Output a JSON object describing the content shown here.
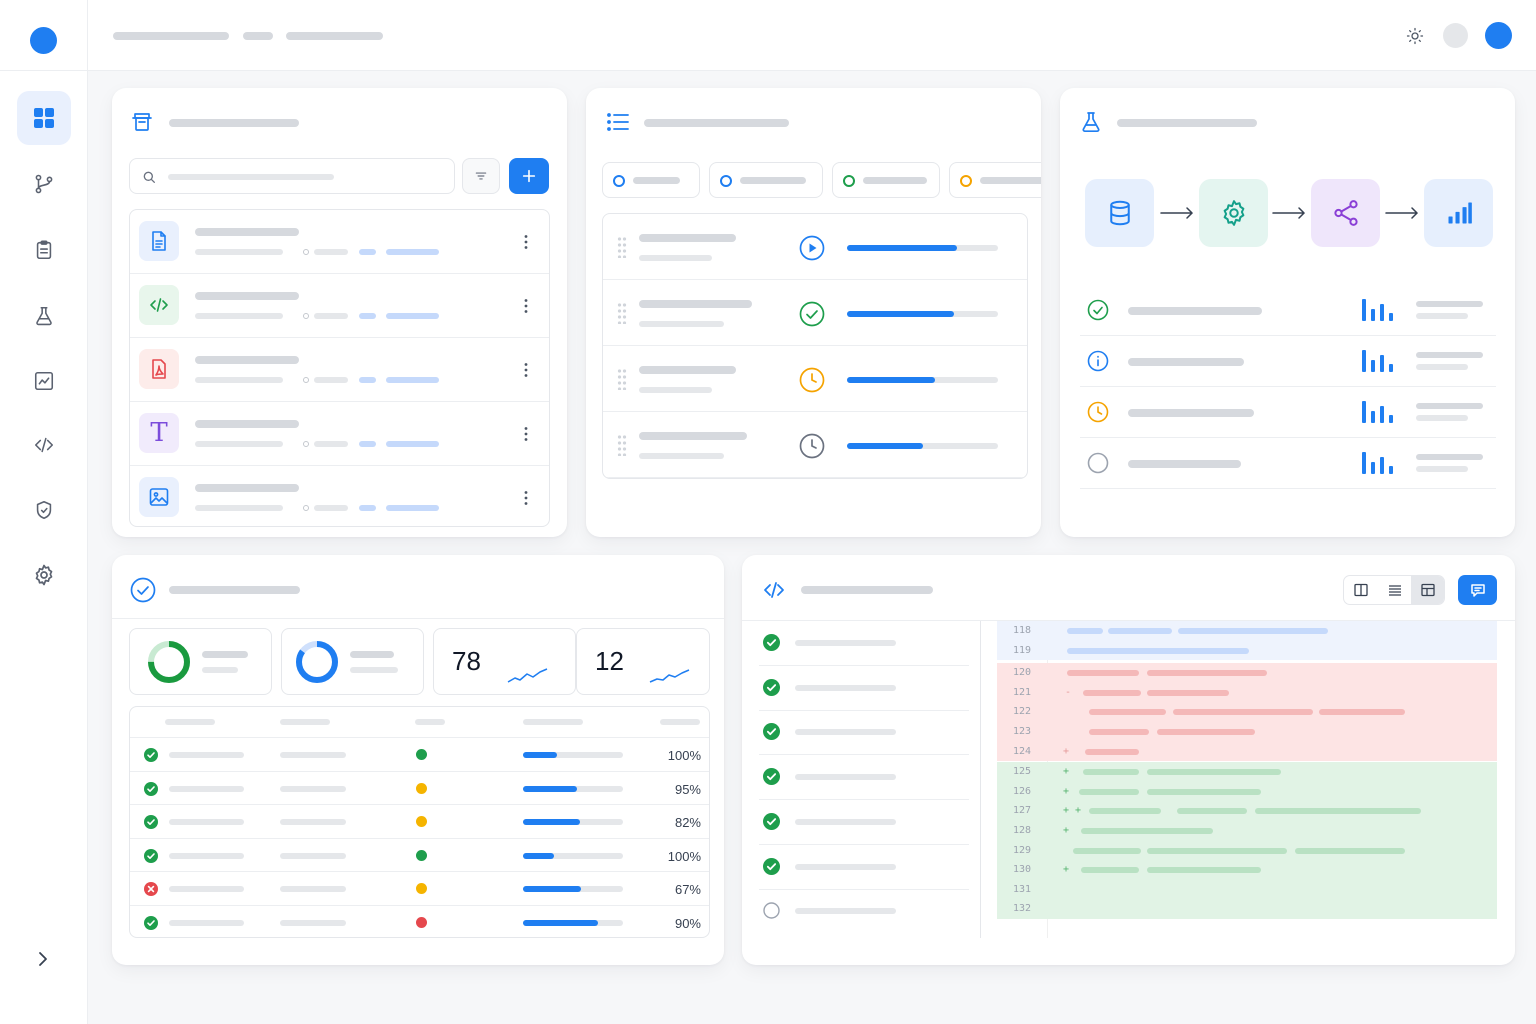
{
  "colors": {
    "primary": "#1f7ef1",
    "success": "#1e9e4c",
    "warning": "#f5b400",
    "danger": "#e5484d",
    "muted": "#9ca3af"
  },
  "sidebar": {
    "logo": "logo-dot",
    "items": [
      {
        "name": "dashboard",
        "icon": "grid-icon",
        "active": true
      },
      {
        "name": "branches",
        "icon": "git-branch-icon"
      },
      {
        "name": "tasks",
        "icon": "clipboard-icon"
      },
      {
        "name": "experiments",
        "icon": "flask-icon"
      },
      {
        "name": "analytics",
        "icon": "chart-line-icon"
      },
      {
        "name": "code",
        "icon": "code-icon"
      },
      {
        "name": "security",
        "icon": "shield-icon"
      },
      {
        "name": "settings",
        "icon": "gear-icon"
      }
    ],
    "collapse_icon": "chevron-right-icon"
  },
  "topbar": {
    "icons": [
      "sun-icon",
      "avatar-placeholder",
      "user-avatar"
    ]
  },
  "files": {
    "icon": "archive-icon",
    "items": [
      {
        "type": "document",
        "icon": "file-text-icon"
      },
      {
        "type": "code",
        "icon": "code-file-icon"
      },
      {
        "type": "pdf",
        "icon": "pdf-icon"
      },
      {
        "type": "text",
        "icon": "text-type-icon",
        "glyph": "T"
      },
      {
        "type": "image",
        "icon": "image-icon"
      }
    ]
  },
  "tasks": {
    "icon": "list-icon",
    "filters": [
      {
        "status": "open",
        "color": "#1f7ef1"
      },
      {
        "status": "open",
        "color": "#1f7ef1"
      },
      {
        "status": "done",
        "color": "#1e9e4c"
      },
      {
        "status": "pending",
        "color": "#f5a300"
      }
    ],
    "items": [
      {
        "status": "running",
        "icon": "play-circle-icon",
        "progress": 0.73
      },
      {
        "status": "done",
        "icon": "check-circle-icon",
        "progress": 0.71
      },
      {
        "status": "pending",
        "icon": "clock-icon",
        "progress": 0.58
      },
      {
        "status": "queued",
        "icon": "clock-icon",
        "progress": 0.5
      }
    ]
  },
  "pipeline": {
    "icon": "flask-icon",
    "stages": [
      {
        "icon": "database-icon"
      },
      {
        "icon": "gear-icon"
      },
      {
        "icon": "share-icon"
      },
      {
        "icon": "bar-chart-icon"
      }
    ],
    "rows": [
      {
        "status": "success",
        "icon": "check-circle-icon"
      },
      {
        "status": "info",
        "icon": "info-circle-icon"
      },
      {
        "status": "pending",
        "icon": "clock-icon"
      },
      {
        "status": "idle",
        "icon": "empty-circle-icon"
      }
    ]
  },
  "tests": {
    "icon": "check-circle-icon",
    "stats": [
      {
        "kind": "donut",
        "value": 0.75
      },
      {
        "kind": "donut",
        "value": 0.85
      },
      {
        "kind": "number",
        "value": "78"
      },
      {
        "kind": "number",
        "value": "12"
      }
    ],
    "rows": [
      {
        "status": "pass",
        "dot": "green",
        "progress": 0.34,
        "pct": "100%"
      },
      {
        "status": "pass",
        "dot": "yellow",
        "progress": 0.54,
        "pct": "95%"
      },
      {
        "status": "pass",
        "dot": "yellow",
        "progress": 0.57,
        "pct": "82%"
      },
      {
        "status": "pass",
        "dot": "green",
        "progress": 0.31,
        "pct": "100%"
      },
      {
        "status": "fail",
        "dot": "yellow",
        "progress": 0.58,
        "pct": "67%"
      },
      {
        "status": "pass",
        "dot": "red",
        "progress": 0.75,
        "pct": "90%"
      }
    ]
  },
  "code_review": {
    "icon": "code-icon",
    "checks": [
      "done",
      "done",
      "done",
      "done",
      "done",
      "done",
      "pending"
    ],
    "view_modes": [
      "split-view-icon",
      "list-view-icon",
      "table-view-icon"
    ],
    "comment_icon": "comment-icon",
    "lines": [
      {
        "n": "118",
        "type": "context",
        "sign": ""
      },
      {
        "n": "119",
        "type": "context",
        "sign": ""
      },
      {
        "n": "120",
        "type": "removed",
        "sign": ""
      },
      {
        "n": "121",
        "type": "removed",
        "sign": "-"
      },
      {
        "n": "122",
        "type": "removed",
        "sign": ""
      },
      {
        "n": "123",
        "type": "removed",
        "sign": ""
      },
      {
        "n": "124",
        "type": "removed",
        "sign": "+"
      },
      {
        "n": "125",
        "type": "added",
        "sign": "+"
      },
      {
        "n": "126",
        "type": "added",
        "sign": "+"
      },
      {
        "n": "127",
        "type": "added",
        "sign": "+ +"
      },
      {
        "n": "128",
        "type": "added",
        "sign": "+"
      },
      {
        "n": "129",
        "type": "added",
        "sign": ""
      },
      {
        "n": "130",
        "type": "added",
        "sign": "+"
      },
      {
        "n": "131",
        "type": "added",
        "sign": ""
      },
      {
        "n": "132",
        "type": "added",
        "sign": ""
      }
    ]
  }
}
